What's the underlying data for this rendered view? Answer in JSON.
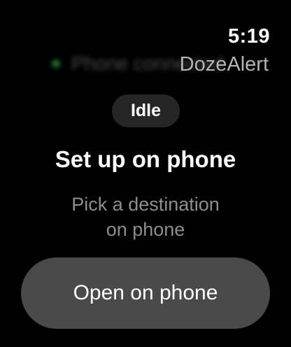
{
  "status_bar": {
    "time": "5:19",
    "app_name": "DozeAlert"
  },
  "connection": {
    "text": "Phone connected",
    "dot_color": "#30d158"
  },
  "state_pill": {
    "label": "Idle"
  },
  "main": {
    "title": "Set up on phone",
    "subtitle_line1": "Pick a destination",
    "subtitle_line2": "on phone"
  },
  "actions": {
    "open_label": "Open on phone"
  },
  "colors": {
    "background": "#000000",
    "button": "#4a4a4a",
    "pill": "#262626",
    "secondary_text": "#8e8e8e"
  }
}
